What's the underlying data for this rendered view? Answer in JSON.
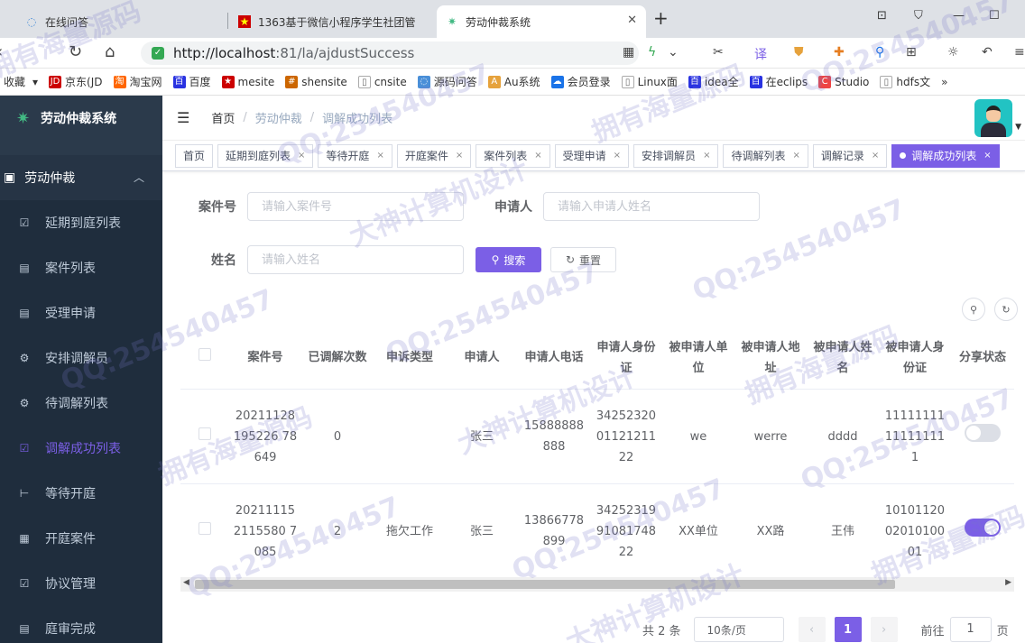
{
  "browser": {
    "tabs": [
      {
        "title": "在线问答"
      },
      {
        "title": "1363基于微信小程序学生社团管"
      },
      {
        "title": "劳动仲裁系统"
      }
    ],
    "url_host": "http://localhost",
    "url_path": ":81/la/ajdustSuccess",
    "bookmarks": [
      "收藏",
      "京东(JD",
      "淘宝网",
      "百度",
      "mesite",
      "shensite",
      "cnsite",
      "源码问答",
      "Au系统",
      "会员登录",
      "Linux面",
      "idea全",
      "在eclips",
      "Studio",
      "hdfs文"
    ]
  },
  "sidebar": {
    "brand": "劳动仲裁系统",
    "group": "劳动仲裁",
    "items": [
      {
        "label": "延期到庭列表",
        "icon": "checkbox-icon"
      },
      {
        "label": "案件列表",
        "icon": "list-icon"
      },
      {
        "label": "受理申请",
        "icon": "list-icon"
      },
      {
        "label": "安排调解员",
        "icon": "gear-icon"
      },
      {
        "label": "待调解列表",
        "icon": "gear-icon"
      },
      {
        "label": "调解成功列表",
        "icon": "checkbox-icon"
      },
      {
        "label": "等待开庭",
        "icon": "tree-icon"
      },
      {
        "label": "开庭案件",
        "icon": "calendar-icon"
      },
      {
        "label": "协议管理",
        "icon": "checkbox-icon"
      },
      {
        "label": "庭审完成",
        "icon": "list-icon"
      }
    ]
  },
  "breadcrumb": [
    "首页",
    "劳动仲裁",
    "调解成功列表"
  ],
  "tags": [
    "首页",
    "延期到庭列表",
    "等待开庭",
    "开庭案件",
    "案件列表",
    "受理申请",
    "安排调解员",
    "待调解列表",
    "调解记录",
    "调解成功列表"
  ],
  "search": {
    "case_label": "案件号",
    "case_placeholder": "请输入案件号",
    "applicant_label": "申请人",
    "applicant_placeholder": "请输入申请人姓名",
    "name_label": "姓名",
    "name_placeholder": "请输入姓名",
    "search_btn": "搜索",
    "reset_btn": "重置"
  },
  "table": {
    "headers": [
      "案件号",
      "已调解次数",
      "申诉类型",
      "申请人",
      "申请人电话",
      "申请人身份证",
      "被申请人单位",
      "被申请人地址",
      "被申请人姓名",
      "被申请人身份证",
      "分享状态"
    ],
    "rows": [
      {
        "case": "20211128195226 78649",
        "times": "0",
        "type": "",
        "applicant": "张三",
        "phone": "15888888888",
        "id": "342523200112121122",
        "unit": "we",
        "addr": "werre",
        "name": "dddd",
        "rid": "11111111111111111",
        "share": false
      },
      {
        "case": "202111152115580 7085",
        "times": "2",
        "type": "拖欠工作",
        "applicant": "张三",
        "phone": "13866778899",
        "id": "342523199108174822",
        "unit": "XX单位",
        "addr": "XX路",
        "name": "王伟",
        "rid": "101011200201010001",
        "share": true
      }
    ]
  },
  "pagination": {
    "total": "共 2 条",
    "size": "10条/页",
    "current": "1",
    "goto_pre": "前往",
    "goto_val": "1",
    "goto_post": "页"
  },
  "watermarks": [
    "拥有海量源码",
    "QQ:254540457",
    "大神计算机设计"
  ],
  "colors": {
    "accent": "#7b5fe6",
    "sidebar": "#2b3a4b"
  }
}
